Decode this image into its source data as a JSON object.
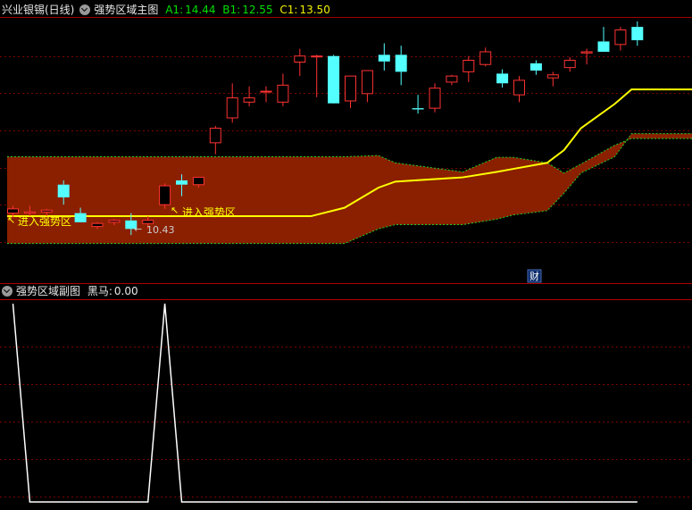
{
  "main_header": {
    "stock": "兴业银锡(日线)",
    "indicator": "强势区域主图",
    "a1_label": "A1:",
    "a1_value": "14.44",
    "b1_label": "B1:",
    "b1_value": "12.55",
    "c1_label": "C1:",
    "c1_value": "13.50"
  },
  "sub_header": {
    "indicator": "强势区域副图",
    "series_label": "黑马:",
    "series_value": "0.00"
  },
  "annotations": {
    "enter_zone_1": "进入强势区",
    "enter_zone_2": "进入强势区",
    "low_price": "10.43",
    "fin_marker": "财"
  },
  "colors": {
    "background": "#000000",
    "up_candle": "#ff3232",
    "down_candle": "#54ffff",
    "band_fill": "#8b2000",
    "midline": "#ffff00",
    "band_edge": "#22cc22",
    "grid": "#7a0000",
    "black_horse_line": "#ffffff"
  },
  "chart_data": [
    {
      "type": "candlestick",
      "title": "强势区域主图",
      "candles": [
        {
          "o": 10.79,
          "h": 10.91,
          "l": 10.72,
          "c": 10.86
        },
        {
          "o": 10.79,
          "h": 10.91,
          "l": 10.74,
          "c": 10.81
        },
        {
          "o": 10.81,
          "h": 10.86,
          "l": 10.74,
          "c": 10.84
        },
        {
          "o": 11.26,
          "h": 11.33,
          "l": 10.93,
          "c": 11.05
        },
        {
          "o": 10.79,
          "h": 10.88,
          "l": 10.66,
          "c": 10.64
        },
        {
          "o": 10.57,
          "h": 10.64,
          "l": 10.53,
          "c": 10.62
        },
        {
          "o": 10.64,
          "h": 10.69,
          "l": 10.59,
          "c": 10.67
        },
        {
          "o": 10.67,
          "h": 10.79,
          "l": 10.43,
          "c": 10.53
        },
        {
          "o": 10.62,
          "h": 10.74,
          "l": 10.53,
          "c": 10.67
        },
        {
          "o": 10.93,
          "h": 11.28,
          "l": 10.86,
          "c": 11.24
        },
        {
          "o": 11.33,
          "h": 11.43,
          "l": 11.07,
          "c": 11.26
        },
        {
          "o": 11.26,
          "h": 11.38,
          "l": 11.21,
          "c": 11.38
        },
        {
          "o": 11.95,
          "h": 12.23,
          "l": 11.76,
          "c": 12.19
        },
        {
          "o": 12.36,
          "h": 12.93,
          "l": 12.28,
          "c": 12.69
        },
        {
          "o": 12.62,
          "h": 12.88,
          "l": 12.55,
          "c": 12.69
        },
        {
          "o": 12.8,
          "h": 12.88,
          "l": 12.62,
          "c": 12.8
        },
        {
          "o": 12.62,
          "h": 13.09,
          "l": 12.55,
          "c": 12.9
        },
        {
          "o": 13.28,
          "h": 13.5,
          "l": 13.05,
          "c": 13.38
        },
        {
          "o": 13.38,
          "h": 13.4,
          "l": 12.7,
          "c": 13.38
        },
        {
          "o": 13.38,
          "h": 13.4,
          "l": 12.62,
          "c": 12.6
        },
        {
          "o": 12.64,
          "h": 13.02,
          "l": 12.52,
          "c": 13.05
        },
        {
          "o": 12.76,
          "h": 13.14,
          "l": 12.62,
          "c": 13.14
        },
        {
          "o": 13.4,
          "h": 13.59,
          "l": 13.14,
          "c": 13.29
        },
        {
          "o": 13.4,
          "h": 13.55,
          "l": 12.9,
          "c": 13.12
        },
        {
          "o": 12.52,
          "h": 12.74,
          "l": 12.43,
          "c": 12.5
        },
        {
          "o": 12.52,
          "h": 12.93,
          "l": 12.45,
          "c": 12.85
        },
        {
          "o": 12.95,
          "h": 13.07,
          "l": 12.9,
          "c": 13.05
        },
        {
          "o": 13.12,
          "h": 13.38,
          "l": 12.95,
          "c": 13.31
        },
        {
          "o": 13.24,
          "h": 13.52,
          "l": 13.21,
          "c": 13.45
        },
        {
          "o": 13.09,
          "h": 13.16,
          "l": 12.86,
          "c": 12.93
        },
        {
          "o": 12.74,
          "h": 13.05,
          "l": 12.62,
          "c": 12.98
        },
        {
          "o": 13.26,
          "h": 13.31,
          "l": 13.07,
          "c": 13.14
        },
        {
          "o": 13.02,
          "h": 13.12,
          "l": 12.88,
          "c": 13.07
        },
        {
          "o": 13.19,
          "h": 13.36,
          "l": 13.12,
          "c": 13.31
        },
        {
          "o": 13.43,
          "h": 13.5,
          "l": 13.24,
          "c": 13.45
        },
        {
          "o": 13.62,
          "h": 13.86,
          "l": 13.5,
          "c": 13.45
        },
        {
          "o": 13.57,
          "h": 13.86,
          "l": 13.47,
          "c": 13.81
        },
        {
          "o": 13.86,
          "h": 13.95,
          "l": 13.55,
          "c": 13.64
        }
      ],
      "band": {
        "x_index": [
          0,
          18,
          20,
          22,
          23,
          27,
          29,
          30,
          32,
          33,
          34,
          36,
          37
        ],
        "upper": [
          11.72,
          11.72,
          11.72,
          11.74,
          11.62,
          11.47,
          11.71,
          11.71,
          11.62,
          11.45,
          11.6,
          11.91,
          12.02
        ],
        "middle": [
          10.74,
          10.74,
          10.88,
          11.21,
          11.31,
          11.38,
          11.47,
          11.52,
          11.62,
          11.83,
          12.19,
          12.59,
          12.83
        ],
        "lower": [
          10.29,
          10.29,
          10.29,
          10.53,
          10.6,
          10.6,
          10.69,
          10.76,
          10.83,
          11.12,
          11.45,
          11.72,
          12.1
        ]
      },
      "ylim": [
        10.24,
        13.95
      ]
    },
    {
      "type": "line",
      "title": "强势区域副图",
      "series": [
        {
          "name": "黑马",
          "values": [
            1,
            0,
            0,
            0,
            0,
            0,
            0,
            0,
            0,
            1,
            0,
            0,
            0,
            0,
            0,
            0,
            0,
            0,
            0,
            0,
            0,
            0,
            0,
            0,
            0,
            0,
            0,
            0,
            0,
            0,
            0,
            0,
            0,
            0,
            0,
            0,
            0,
            0
          ]
        }
      ],
      "ylim": [
        0,
        1
      ]
    }
  ]
}
